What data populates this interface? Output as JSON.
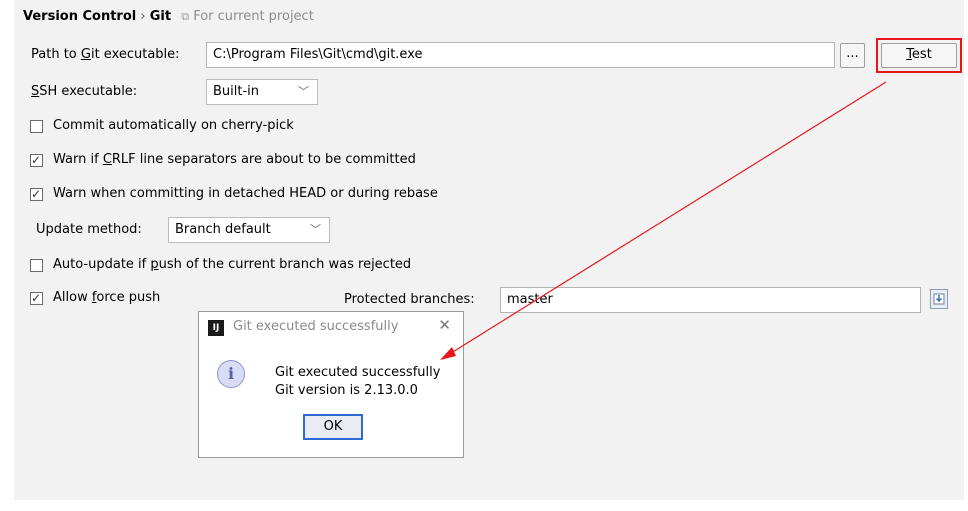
{
  "breadcrumb": {
    "section": "Version Control",
    "separator": "›",
    "page": "Git",
    "scope": "For current project"
  },
  "git_path": {
    "label_pre": "Path to ",
    "label_mnemonic": "G",
    "label_post": "it executable:",
    "value": "C:\\Program Files\\Git\\cmd\\git.exe",
    "browse_label": "...",
    "test_mnemonic": "T",
    "test_post": "est"
  },
  "ssh": {
    "label_mnemonic": "S",
    "label_post": "SH executable:",
    "value": "Built-in"
  },
  "options": {
    "cherry_pick": {
      "label": "Commit automatically on cherry-pick",
      "checked": false
    },
    "crlf": {
      "pre": "Warn if ",
      "mnemonic": "C",
      "post": "RLF line separators are about to be committed",
      "checked": true
    },
    "detached": {
      "label": "Warn when committing in detached HEAD or during rebase",
      "checked": true
    },
    "auto_update": {
      "pre": "Auto-update if ",
      "mnemonic": "p",
      "post": "ush of the current branch was rejected",
      "checked": false
    },
    "force_push": {
      "pre": "Allow ",
      "mnemonic": "f",
      "post": "orce push",
      "checked": true
    }
  },
  "update_method": {
    "label": "Update method:",
    "value": "Branch default"
  },
  "protected_branches": {
    "label": "Protected branches:",
    "value": "master"
  },
  "dialog": {
    "title": "Git executed successfully",
    "logo": "IJ",
    "message_line1": "Git executed successfully",
    "message_line2": "Git version is 2.13.0.0",
    "ok_label": "OK"
  },
  "annotation": {
    "color": "#e8151b"
  }
}
